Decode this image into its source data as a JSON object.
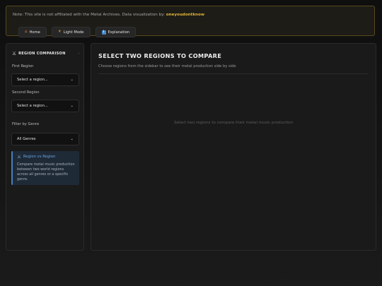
{
  "notice": {
    "text": "Note: This site is not affiliated with the Metal Archives. Data visualization by: ",
    "author": "oneyoudontknow"
  },
  "nav": [
    {
      "icon": "home-icon",
      "label": "Home"
    },
    {
      "icon": "sun-icon",
      "label": "Light Mode"
    },
    {
      "icon": "info-icon",
      "label": "Explanation"
    }
  ],
  "sidebar": {
    "title": "REGION COMPARISON",
    "first_region_label": "First Region",
    "first_region_value": "Select a region...",
    "second_region_label": "Second Region",
    "second_region_value": "Select a region...",
    "genre_label": "Filter by Genre",
    "genre_value": "All Genres",
    "info_title": "Region vs Region",
    "info_text": "Compare metal music production between two world regions across all genres or a specific genre."
  },
  "main": {
    "title": "SELECT TWO REGIONS TO COMPARE",
    "subtitle": "Choose regions from the sidebar to see their metal production side by side",
    "empty_text": "Select two regions to compare their metal music production"
  },
  "colors": {
    "accent": "#e0b53a",
    "info_blue": "#4a7fb8"
  }
}
